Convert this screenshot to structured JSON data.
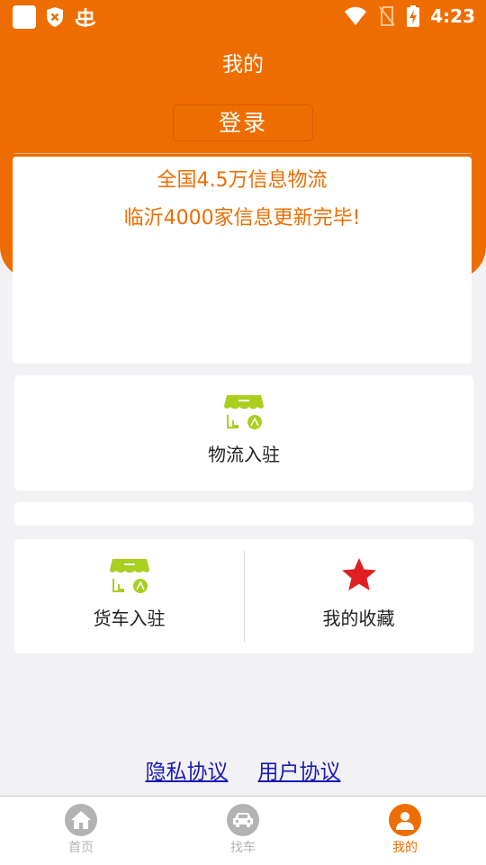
{
  "status_bar": {
    "time": "4:23"
  },
  "header": {
    "title": "我的",
    "login_label": "登录"
  },
  "notice": {
    "line1": "全国4.5万信息物流",
    "line2": "临沂4000家信息更新完毕!"
  },
  "features": {
    "logistics_join": "物流入驻",
    "truck_join": "货车入驻",
    "my_favorites": "我的收藏"
  },
  "links": {
    "privacy": "隐私协议",
    "user_agreement": "用户协议"
  },
  "tabs": [
    {
      "label": "首页",
      "icon": "home-icon",
      "active": false
    },
    {
      "label": "找车",
      "icon": "car-icon",
      "active": false
    },
    {
      "label": "我的",
      "icon": "user-icon",
      "active": true
    }
  ],
  "colors": {
    "brand_orange": "#ee6d00",
    "icon_green": "#a9cf1f",
    "star_red": "#e02020",
    "tab_inactive": "#b3b3b3",
    "link_blue": "#1a1ab5"
  }
}
